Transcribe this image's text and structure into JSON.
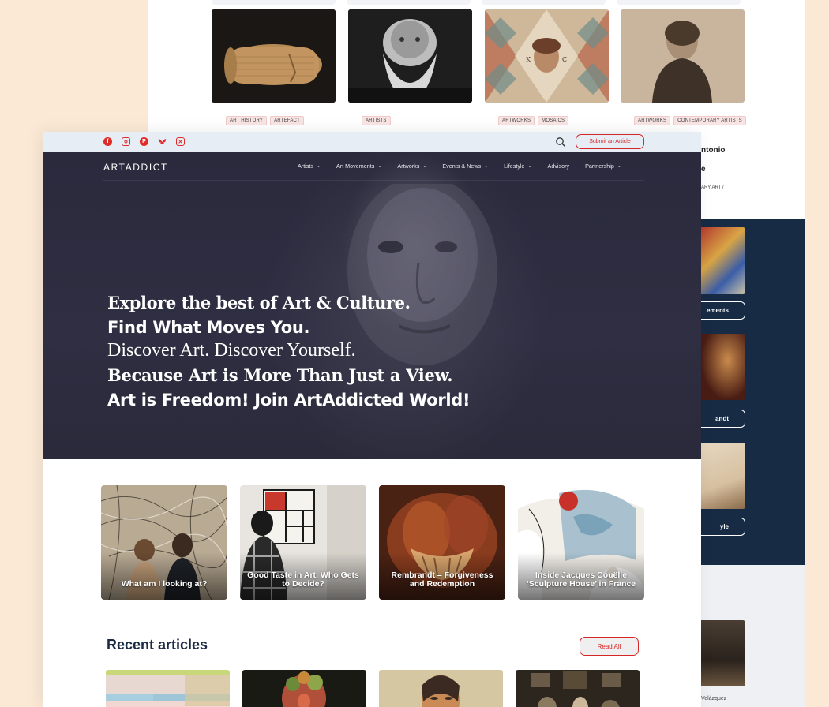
{
  "background_page": {
    "cards": [
      {
        "tags": [
          "ART HISTORY",
          "ARTEFACT"
        ]
      },
      {
        "tags": [
          "ARTISTS"
        ]
      },
      {
        "tags": [
          "ARTWORKS",
          "MOSAICS"
        ]
      },
      {
        "tags": [
          "ARTWORKS",
          "CONTEMPORARY ARTISTS"
        ]
      }
    ],
    "partial_texts": {
      "antonio": "ntonio",
      "e": "e",
      "ary_art": "ARY ART /",
      "movements_btn": "ements",
      "rembrandt_btn": "andt",
      "lifestyle_btn": "yle",
      "velazquez": "Velázquez"
    }
  },
  "topbar": {
    "social_icons": [
      "facebook-icon",
      "instagram-icon",
      "pinterest-icon",
      "bluesky-icon",
      "x-icon"
    ],
    "submit_label": "Submit an Article"
  },
  "header": {
    "logo": "ARTADDICT",
    "nav": [
      {
        "label": "Artists",
        "has_dropdown": true
      },
      {
        "label": "Art Movements",
        "has_dropdown": true
      },
      {
        "label": "Artworks",
        "has_dropdown": true
      },
      {
        "label": "Events & News",
        "has_dropdown": true
      },
      {
        "label": "Lifestyle",
        "has_dropdown": true
      },
      {
        "label": "Advisory",
        "has_dropdown": false
      },
      {
        "label": "Partnership",
        "has_dropdown": true
      }
    ]
  },
  "hero": {
    "lines": [
      "Explore the best of Art & Culture.",
      "Find What Moves You.",
      "Discover Art. Discover Yourself.",
      "Because Art is More Than Just a View.",
      "Art is Freedom! Join ArtAddicted World!"
    ]
  },
  "featured": [
    {
      "title": "What am I looking at?"
    },
    {
      "title": "Good Taste in Art. Who Gets to Decide?"
    },
    {
      "title": "Rembrandt – Forgiveness and Redemption"
    },
    {
      "title": "Inside Jacques Couëlle ‘Sculpture House’ in France"
    }
  ],
  "recent": {
    "title": "Recent articles",
    "read_all_label": "Read All"
  },
  "colors": {
    "accent": "#d72626",
    "hero_bg": "#2b2a3d",
    "page_bg": "#fbe9d6",
    "dark_side": "#172b45"
  }
}
